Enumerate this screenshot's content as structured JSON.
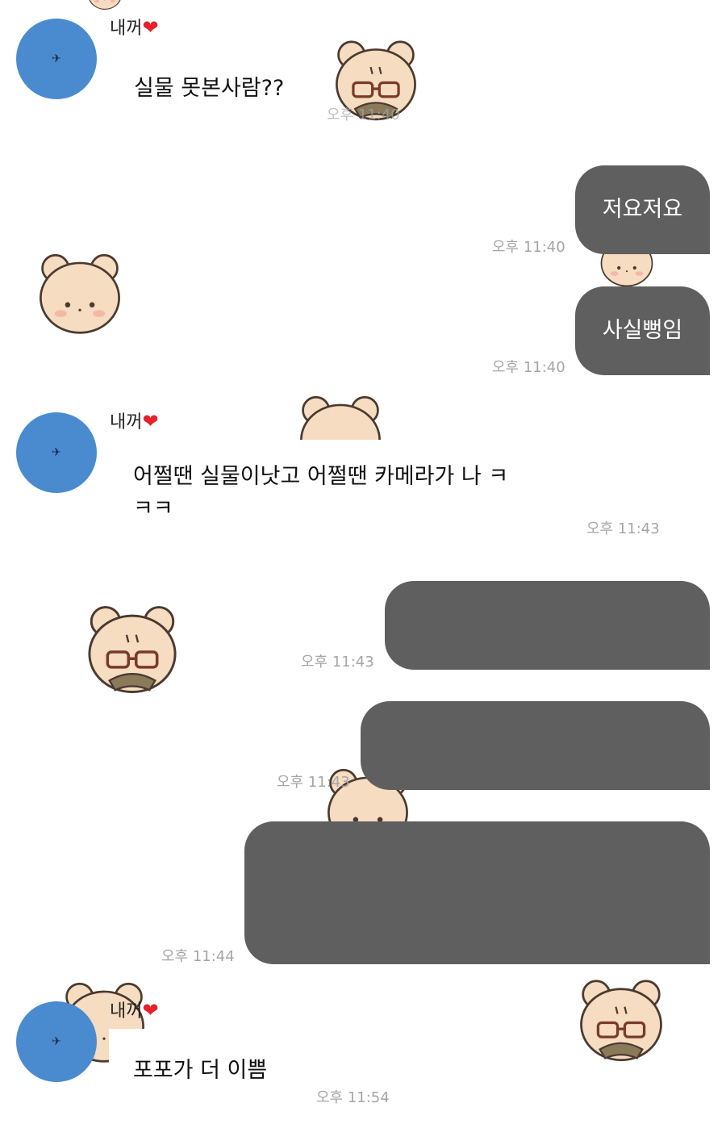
{
  "messages": [
    {
      "type": "incoming",
      "sender": "내꺼",
      "heart": "❤",
      "text": "실물 못본사람??",
      "time": "오후 11:40"
    },
    {
      "type": "outgoing",
      "text": "저요저요",
      "time": "오후 11:40"
    },
    {
      "type": "outgoing",
      "text": "사실뻥임",
      "time": "오후 11:40"
    },
    {
      "type": "incoming",
      "sender": "내꺼",
      "heart": "❤",
      "text_line1": "어쩔땐 실물이낫고 어쩔땐 카메라가 나 ㅋ",
      "text_line2": "ㅋㅋ",
      "time": "오후 11:43"
    },
    {
      "type": "outgoing",
      "text": "",
      "time": "오후 11:43",
      "redacted": true
    },
    {
      "type": "outgoing",
      "text": "",
      "time": "오후 11:43",
      "redacted": true
    },
    {
      "type": "outgoing",
      "text": "",
      "time": "오후 11:44",
      "redacted": true
    },
    {
      "type": "incoming",
      "sender": "내꺼",
      "heart": "❤",
      "text": "포포가 더 이쁨",
      "time": "오후 11:54"
    }
  ],
  "colors": {
    "avatar": "#4a8bd0",
    "outgoing_bubble": "#5f5f5f",
    "heart": "#e8202a",
    "timestamp": "#a6a6a6"
  },
  "icons": {
    "avatar_glyph": "airplane-icon",
    "sticker": "bear-sticker"
  }
}
